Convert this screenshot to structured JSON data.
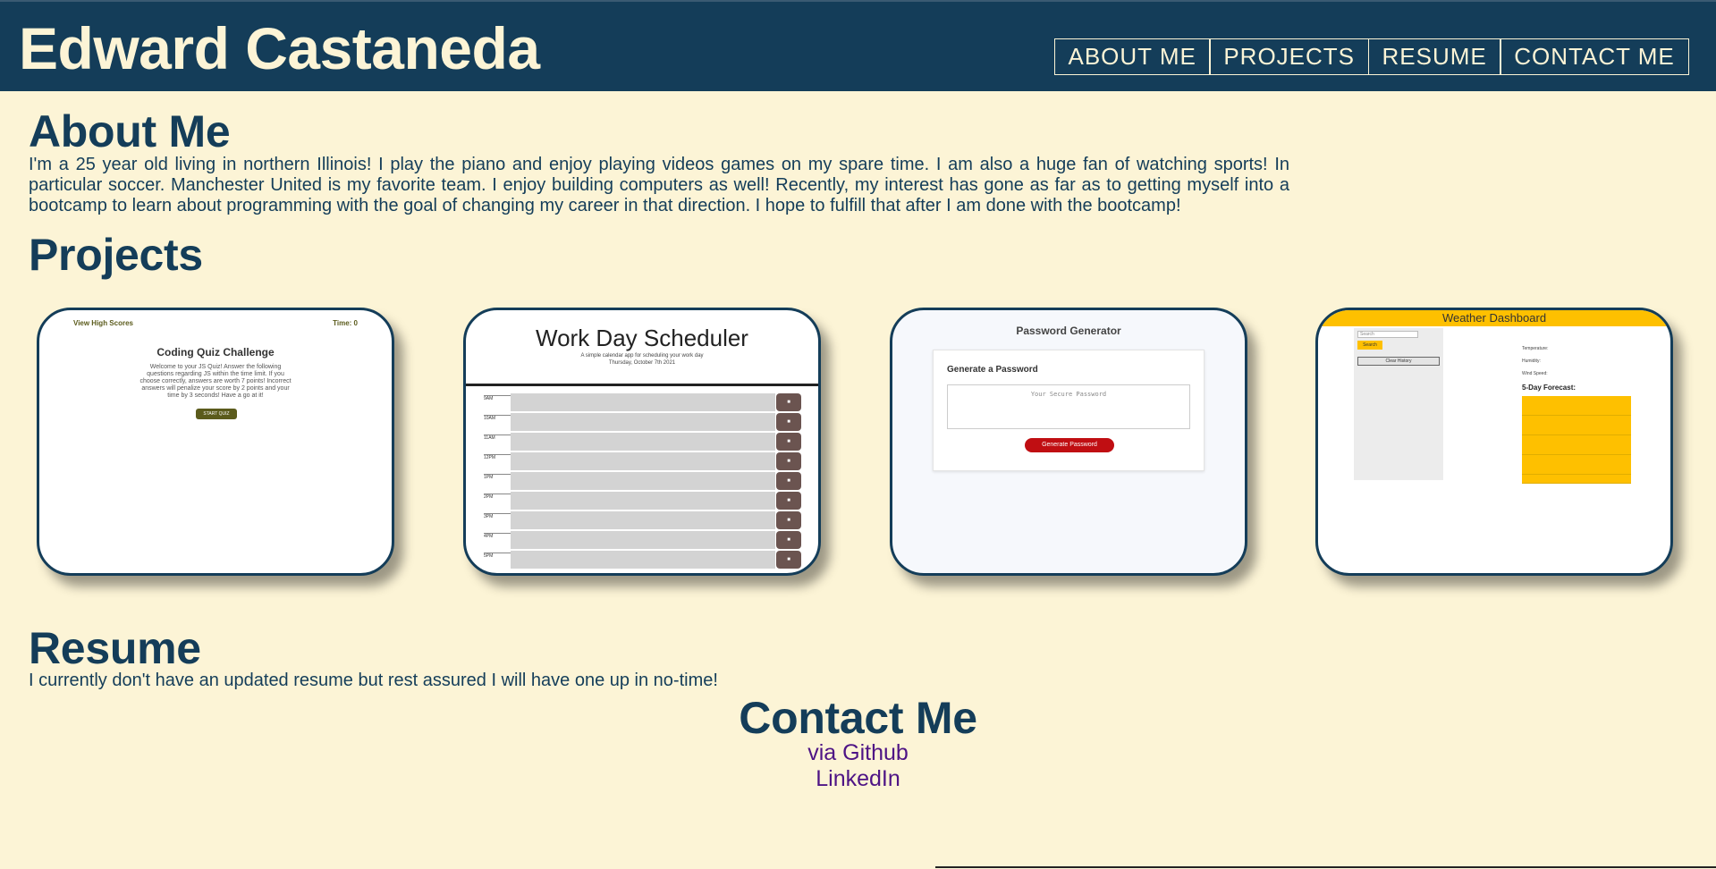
{
  "header": {
    "title": "Edward Castaneda",
    "nav": [
      "ABOUT ME",
      "PROJECTS",
      "RESUME",
      "CONTACT ME"
    ]
  },
  "about": {
    "title": "About Me",
    "text": "I'm a 25 year old living in northern Illinois! I play the piano and enjoy playing videos games on my spare time. I am also a huge fan of watching sports! In particular soccer. Manchester United is my favorite team. I enjoy building computers as well! Recently, my interest has gone as far as to getting myself into a bootcamp to learn about programming with the goal of changing my career in that direction. I hope to fulfill that after I am done with the bootcamp!"
  },
  "projects": {
    "title": "Projects",
    "quiz": {
      "high_scores": "View High Scores",
      "timer": "Time: 0",
      "title": "Coding Quiz Challenge",
      "description": "Welcome to your JS Quiz! Answer the following questions regarding JS within the time limit. If you choose correctly, answers are worth 7 points! Incorrect answers will penalize your score by 2 points and your time by 3 seconds! Have a go at it!",
      "start": "START QUIZ"
    },
    "scheduler": {
      "title": "Work Day Scheduler",
      "subtitle": "A simple calendar app for scheduling your work day",
      "date": "Thursday, October 7th 2021",
      "hours": [
        "9AM",
        "10AM",
        "11AM",
        "12PM",
        "1PM",
        "2PM",
        "3PM",
        "4PM",
        "5PM"
      ]
    },
    "password": {
      "title": "Password Generator",
      "subtitle": "Generate a Password",
      "placeholder": "Your Secure Password",
      "button": "Generate Password"
    },
    "weather": {
      "title": "Weather Dashboard",
      "search_placeholder": "Search",
      "search_button": "Search",
      "clear_button": "Clear History",
      "temperature": "Temperature:",
      "humidity": "Humidity:",
      "wind": "Wind Speed:",
      "forecast": "5-Day Forecast:"
    }
  },
  "resume": {
    "title": "Resume",
    "text": "I currently don't have an updated resume but rest assured I will have one up in no-time!"
  },
  "contact": {
    "title": "Contact Me",
    "links": [
      "via Github",
      "LinkedIn"
    ]
  },
  "colors": {
    "header_bg": "#143d59",
    "page_bg": "#fcf4d6",
    "link": "#4e1485"
  }
}
